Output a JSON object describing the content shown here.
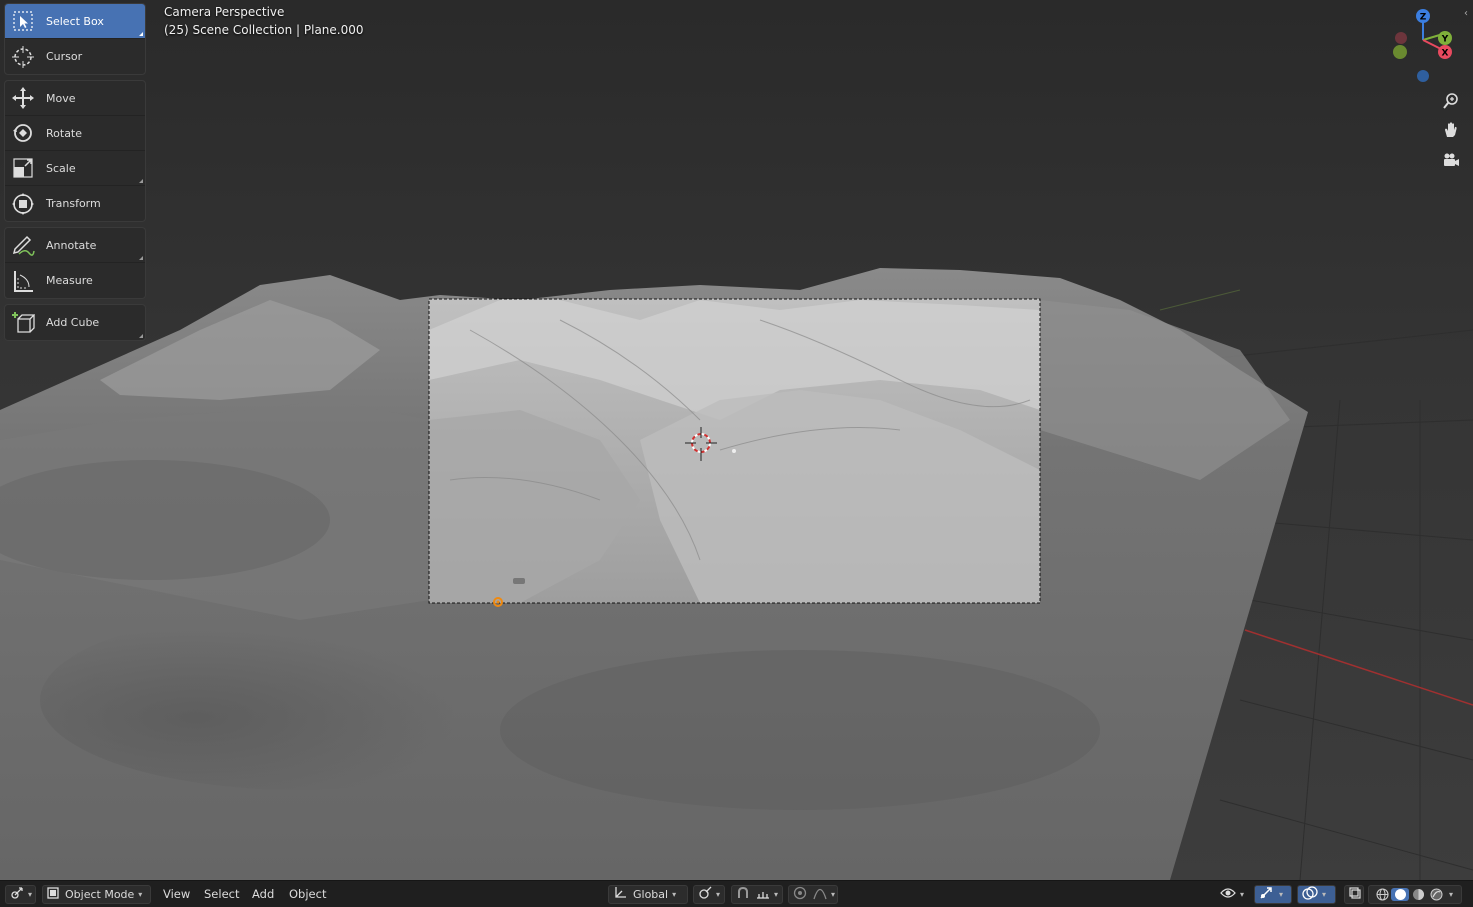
{
  "overlay": {
    "view_name": "Camera Perspective",
    "scene_info": "(25) Scene Collection | Plane.000"
  },
  "toolbar": {
    "groups": [
      [
        {
          "label": "Select Box",
          "icon": "select-box-icon",
          "active": true
        },
        {
          "label": "Cursor",
          "icon": "cursor-icon",
          "active": false
        }
      ],
      [
        {
          "label": "Move",
          "icon": "move-icon",
          "active": false
        },
        {
          "label": "Rotate",
          "icon": "rotate-icon",
          "active": false
        },
        {
          "label": "Scale",
          "icon": "scale-icon",
          "active": false
        },
        {
          "label": "Transform",
          "icon": "transform-icon",
          "active": false
        }
      ],
      [
        {
          "label": "Annotate",
          "icon": "annotate-icon",
          "active": false
        },
        {
          "label": "Measure",
          "icon": "measure-icon",
          "active": false
        }
      ],
      [
        {
          "label": "Add Cube",
          "icon": "add-cube-icon",
          "active": false
        }
      ]
    ]
  },
  "gizmo": {
    "axes": {
      "x": "X",
      "y": "Y",
      "z": "Z"
    },
    "colors": {
      "x": "#e84a5f",
      "y": "#7fb03a",
      "z": "#3b7ee0"
    }
  },
  "nav_icons": [
    "zoom-icon",
    "pan-hand-icon",
    "camera-view-icon"
  ],
  "header": {
    "editor_type_icon": "3d-viewport-icon",
    "mode": "Object Mode",
    "menus": [
      "View",
      "Select",
      "Add",
      "Object"
    ],
    "orientation": "Global",
    "pivot_icon": "pivot-icon",
    "snap_icon": "snap-icon",
    "proportional_icon": "proportional-edit-icon",
    "shading_modes": [
      "wireframe",
      "solid",
      "material-preview",
      "rendered"
    ],
    "active_shading": "solid"
  },
  "colors": {
    "accent": "#4772b3",
    "background": "#3c3c3c",
    "header": "#1f1f1f"
  }
}
